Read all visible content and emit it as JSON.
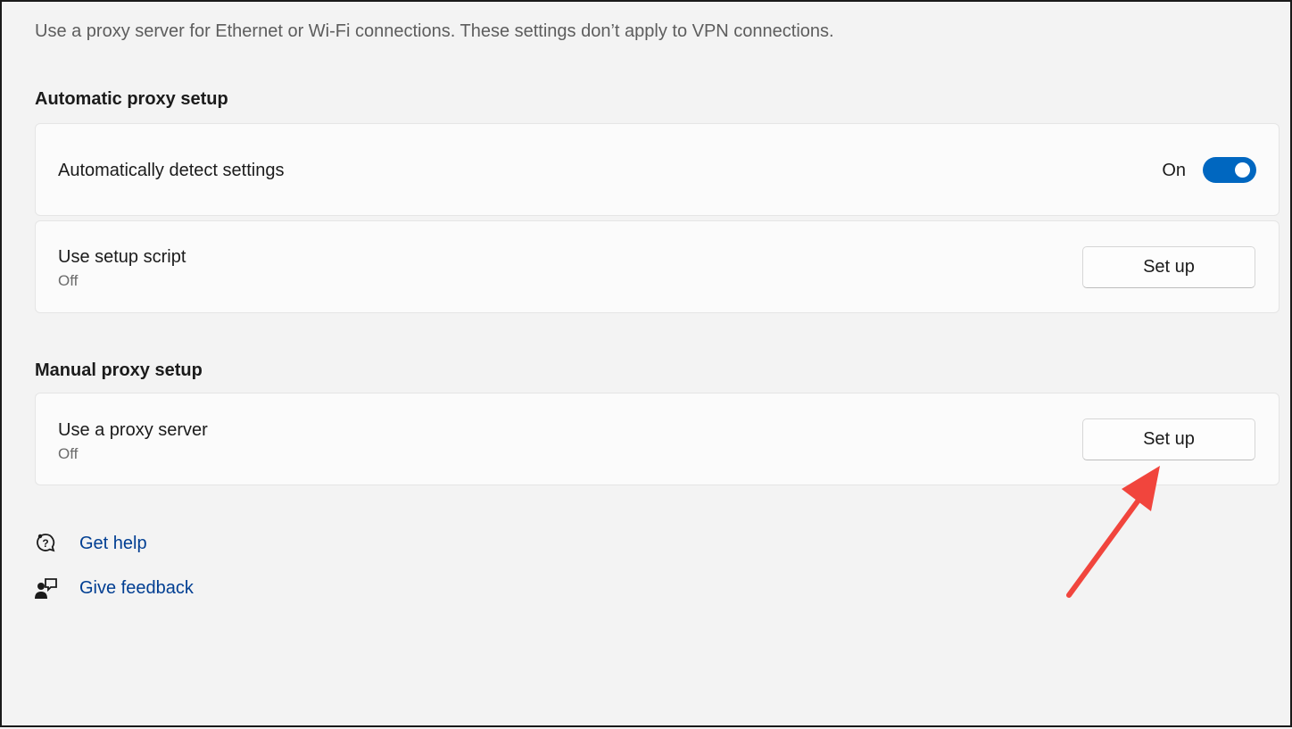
{
  "intro": "Use a proxy server for Ethernet or Wi-Fi connections. These settings don’t apply to VPN connections.",
  "automatic": {
    "title": "Automatic proxy setup",
    "detect": {
      "label": "Automatically detect settings",
      "state": "On",
      "on": true
    },
    "script": {
      "label": "Use setup script",
      "status": "Off",
      "button": "Set up"
    }
  },
  "manual": {
    "title": "Manual proxy setup",
    "proxy": {
      "label": "Use a proxy server",
      "status": "Off",
      "button": "Set up"
    }
  },
  "links": {
    "help": {
      "label": "Get help",
      "icon": "help-chat-icon"
    },
    "feedback": {
      "label": "Give feedback",
      "icon": "feedback-icon"
    }
  },
  "colors": {
    "accent": "#0067c0",
    "link": "#003e92",
    "annotation_arrow": "#f1453d"
  }
}
